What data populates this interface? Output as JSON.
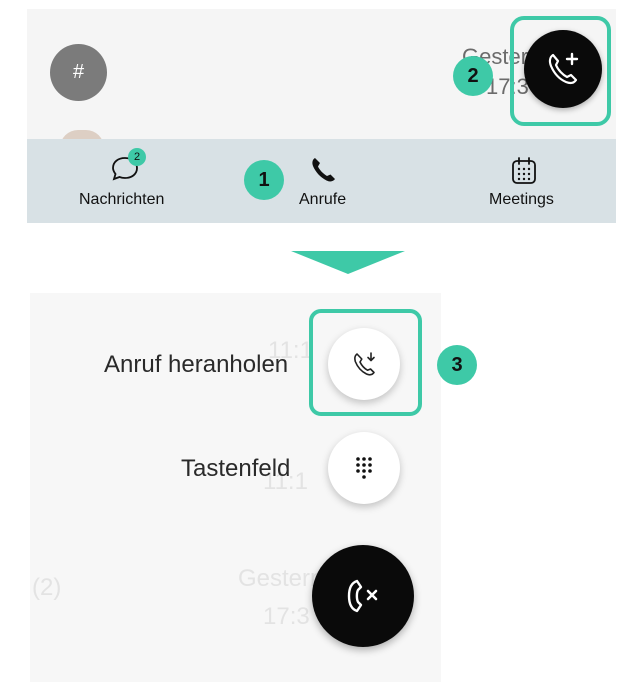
{
  "top_list": {
    "hash_avatar_text": "#",
    "date_label": "Gestern",
    "time_label": "17:3"
  },
  "callouts": {
    "one": "1",
    "two": "2",
    "three": "3"
  },
  "tabbar": {
    "messages_label": "Nachrichten",
    "messages_badge": "2",
    "calls_label": "Anrufe",
    "meetings_label": "Meetings"
  },
  "fab_menu": {
    "pickup_label": "Anruf heranholen",
    "keypad_label": "Tastenfeld"
  },
  "faded_bg": {
    "time_a": "11:1",
    "time_b": "11:1",
    "count": "(2)",
    "date": "Gestern",
    "time_c": "17:3"
  },
  "colors": {
    "accent": "#3ec9a7",
    "fab": "#0a0a0a",
    "tabbar": "#d8e1e5"
  },
  "icons": {
    "new_call": "phone-plus-icon",
    "pickup": "phone-pickup-icon",
    "keypad": "dialpad-icon",
    "close": "phone-close-icon",
    "messages": "chat-bubble-icon",
    "calls": "phone-icon",
    "meetings": "calendar-icon"
  }
}
